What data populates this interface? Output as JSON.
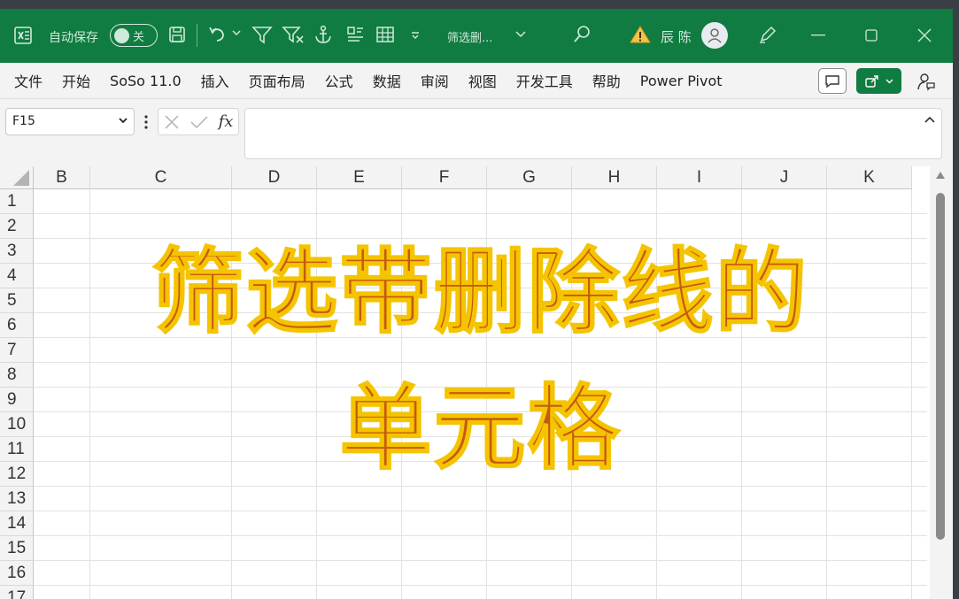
{
  "titlebar": {
    "autosave_label": "自动保存",
    "autosave_state": "关",
    "filename": "筛选删...",
    "user_name": "辰 陈",
    "accent": "#107c41"
  },
  "menu": {
    "items": [
      "文件",
      "开始",
      "SoSo 11.0",
      "插入",
      "页面布局",
      "公式",
      "数据",
      "审阅",
      "视图",
      "开发工具",
      "帮助",
      "Power Pivot"
    ]
  },
  "formula_bar": {
    "name_box": "F15",
    "fx_label": "fx",
    "formula": ""
  },
  "sheet": {
    "columns": [
      "B",
      "C",
      "D",
      "E",
      "F",
      "G",
      "H",
      "I",
      "J",
      "K"
    ],
    "rows": [
      "1",
      "2",
      "3",
      "4",
      "5",
      "6",
      "7",
      "8",
      "9",
      "10",
      "11",
      "12",
      "13",
      "14",
      "15",
      "16",
      "17"
    ],
    "overlay_line1": "筛选带删除线的",
    "overlay_line2": "单元格",
    "overlay_fill": "#c55a11",
    "overlay_stroke": "#f5c400"
  }
}
